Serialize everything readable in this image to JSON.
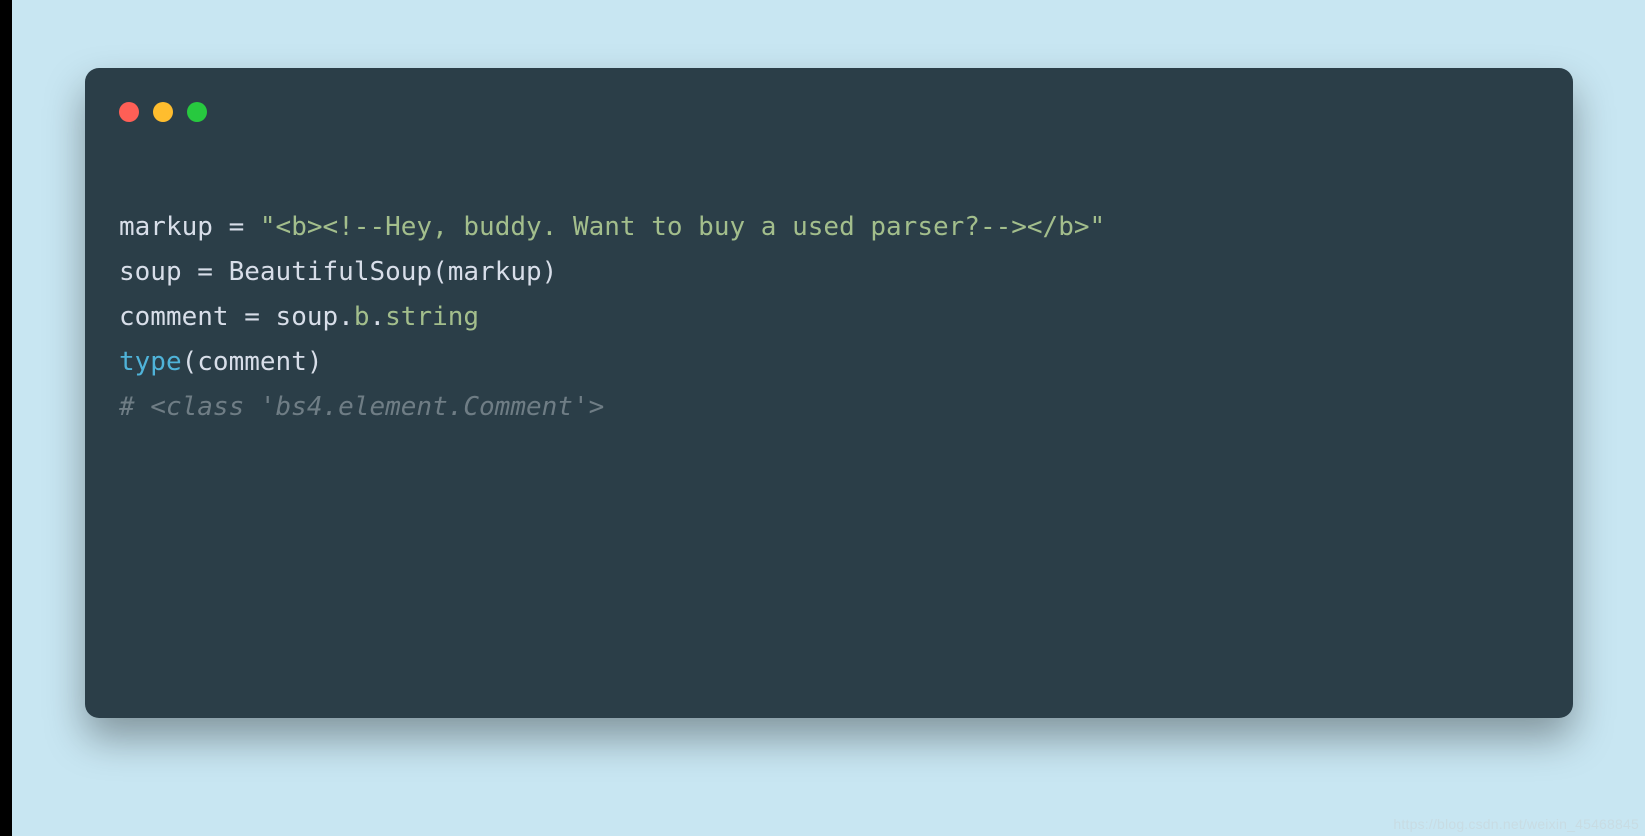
{
  "colors": {
    "page_bg": "#c8e6f2",
    "card_bg": "#2b3e48",
    "dot_red": "#ff5f56",
    "dot_yellow": "#ffbd2e",
    "dot_green": "#27c93f",
    "text_default": "#d8dee9",
    "text_string": "#a3be8c",
    "text_keyword": "#4fb3d9",
    "text_comment": "#6f7d85"
  },
  "code": {
    "line1": {
      "var": "markup",
      "op": " = ",
      "str": "\"<b><!--Hey, buddy. Want to buy a used parser?--></b>\""
    },
    "line2": {
      "var": "soup",
      "op": " = ",
      "call": "BeautifulSoup",
      "paren_open": "(",
      "arg": "markup",
      "paren_close": ")"
    },
    "line3": {
      "var": "comment",
      "op": " = ",
      "obj": "soup",
      "dot1": ".",
      "attr1": "b",
      "dot2": ".",
      "attr2": "string"
    },
    "line4": {
      "kw": "type",
      "paren_open": "(",
      "arg": "comment",
      "paren_close": ")"
    },
    "line5": {
      "cmt": "# <class 'bs4.element.Comment'>"
    }
  },
  "watermark": "https://blog.csdn.net/weixin_45468845"
}
